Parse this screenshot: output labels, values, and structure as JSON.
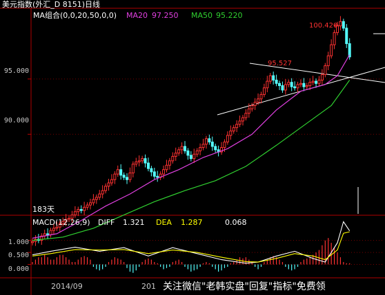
{
  "title": "美元指数(外汇_D 8151)日线",
  "legend": {
    "ma_params": "MA组合(0,0,20,50,0,0)",
    "ma20_label": "MA20",
    "ma20_value": "97.250",
    "ma50_label": "MA50",
    "ma50_value": "95.220"
  },
  "colors": {
    "up": "#ff3232",
    "down": "#54ffff",
    "ma20": "#e040e0",
    "ma50": "#30d030",
    "axis_text": "#c8c8c8",
    "grid": "#7a0000",
    "annotation": "#ff3232",
    "dif": "#ffffff",
    "dea": "#ffff00"
  },
  "annotations": {
    "high": "100.420",
    "high_arrow": "←",
    "mid_high": "95.527",
    "days": "183天"
  },
  "macd": {
    "title": "MACD(12,26,9)",
    "diff_label": "DIFF",
    "diff_value": "1.321",
    "dea_label": "DEA",
    "dea_value": "1.287",
    "macd_value": "0.068"
  },
  "watermark": "关注微信\"老韩实盘\"回复\"指标\"免费领",
  "chart_data": [
    {
      "type": "line",
      "title": "美元指数(外汇_D 8151)日线",
      "y_ticks": [
        "95.000",
        "90.000"
      ],
      "y_tick_values": [
        95.0,
        90.0
      ],
      "ylim": [
        82.8,
        101.4
      ],
      "x_tick_labels": [
        "2014/09",
        "201"
      ],
      "grid": true,
      "candles": {
        "start": 80.2,
        "closes": [
          80.3,
          80.5,
          80.4,
          80.8,
          81.0,
          80.9,
          81.3,
          81.5,
          81.6,
          81.9,
          82.1,
          82.3,
          82.4,
          82.7,
          83.0,
          83.2,
          83.1,
          83.4,
          83.6,
          83.8,
          84.1,
          84.3,
          84.6,
          84.9,
          85.3,
          85.6,
          85.9,
          86.4,
          86.8,
          86.3,
          86.1,
          85.9,
          86.5,
          87.3,
          87.5,
          87.6,
          87.8,
          87.4,
          86.9,
          86.6,
          86.2,
          86.1,
          86.4,
          86.8,
          87.2,
          87.6,
          88.0,
          88.3,
          88.6,
          88.9,
          88.5,
          88.1,
          87.8,
          88.2,
          88.5,
          88.8,
          89.1,
          89.6,
          89.3,
          88.9,
          88.6,
          88.4,
          88.8,
          89.3,
          89.9,
          90.3,
          90.6,
          90.9,
          91.2,
          91.5,
          91.9,
          92.3,
          92.6,
          92.9,
          93.2,
          93.6,
          94.2,
          94.8,
          95.3,
          94.9,
          94.6,
          94.4,
          94.0,
          94.5,
          94.7,
          94.3,
          94.2,
          94.5,
          94.6,
          94.3,
          94.4,
          94.7,
          94.8,
          94.6,
          94.9,
          95.4,
          96.2,
          97.1,
          98.1,
          99.2,
          99.8,
          100.2,
          99.6,
          98.2,
          97.0
        ]
      },
      "series": [
        {
          "name": "MA20",
          "color_key": "ma20",
          "points": [
            [
              0,
              80.6
            ],
            [
              8,
              81.0
            ],
            [
              16,
              82.2
            ],
            [
              24,
              83.5
            ],
            [
              32,
              84.6
            ],
            [
              40,
              85.9
            ],
            [
              48,
              86.8
            ],
            [
              56,
              87.9
            ],
            [
              64,
              88.7
            ],
            [
              72,
              90.0
            ],
            [
              80,
              92.2
            ],
            [
              88,
              93.9
            ],
            [
              96,
              94.5
            ],
            [
              100,
              95.3
            ],
            [
              104,
              97.2
            ]
          ]
        },
        {
          "name": "MA50",
          "color_key": "ma50",
          "points": [
            [
              0,
              80.4
            ],
            [
              10,
              80.7
            ],
            [
              20,
              81.5
            ],
            [
              30,
              82.7
            ],
            [
              40,
              83.9
            ],
            [
              50,
              84.9
            ],
            [
              60,
              85.8
            ],
            [
              70,
              87.1
            ],
            [
              80,
              89.0
            ],
            [
              90,
              91.0
            ],
            [
              98,
              92.6
            ],
            [
              104,
              94.9
            ]
          ]
        }
      ]
    },
    {
      "type": "line",
      "title": "MACD(12,26,9)",
      "y_ticks": [
        "1.000",
        "0.500",
        "0.000"
      ],
      "y_tick_values": [
        1.0,
        0.5,
        0.0
      ],
      "ylim": [
        -0.5,
        2.05
      ],
      "series": [
        {
          "name": "DIFF",
          "color_key": "dif",
          "points": [
            [
              0,
              0.4
            ],
            [
              6,
              0.55
            ],
            [
              14,
              0.72
            ],
            [
              22,
              0.55
            ],
            [
              30,
              0.7
            ],
            [
              38,
              0.35
            ],
            [
              46,
              0.7
            ],
            [
              54,
              0.45
            ],
            [
              62,
              0.2
            ],
            [
              70,
              0.05
            ],
            [
              74,
              0.1
            ],
            [
              80,
              0.35
            ],
            [
              86,
              0.55
            ],
            [
              92,
              0.25
            ],
            [
              96,
              0.1
            ],
            [
              100,
              0.9
            ],
            [
              102,
              1.78
            ],
            [
              104,
              1.4
            ]
          ]
        },
        {
          "name": "DEA",
          "color_key": "dea",
          "points": [
            [
              0,
              0.35
            ],
            [
              6,
              0.45
            ],
            [
              14,
              0.62
            ],
            [
              22,
              0.6
            ],
            [
              30,
              0.62
            ],
            [
              38,
              0.45
            ],
            [
              46,
              0.6
            ],
            [
              54,
              0.5
            ],
            [
              62,
              0.3
            ],
            [
              70,
              0.12
            ],
            [
              74,
              0.1
            ],
            [
              80,
              0.25
            ],
            [
              86,
              0.45
            ],
            [
              92,
              0.35
            ],
            [
              96,
              0.2
            ],
            [
              100,
              0.6
            ],
            [
              102,
              1.3
            ],
            [
              104,
              1.36
            ]
          ]
        }
      ],
      "histogram": [
        0.1,
        0.2,
        0.3,
        0.3,
        0.4,
        0.3,
        0.2,
        0.2,
        0.3,
        0.4,
        0.4,
        0.3,
        0.2,
        0.1,
        0.1,
        0.2,
        0.3,
        0.35,
        0.3,
        0.2,
        -0.1,
        -0.2,
        -0.25,
        -0.2,
        -0.1,
        0.1,
        0.2,
        0.3,
        0.25,
        0.2,
        0.1,
        -0.15,
        -0.3,
        -0.35,
        -0.25,
        -0.1,
        0.1,
        0.2,
        0.25,
        0.2,
        0.1,
        0.05,
        -0.1,
        -0.2,
        -0.15,
        -0.1,
        0.1,
        0.15,
        0.2,
        0.1,
        -0.1,
        -0.2,
        -0.3,
        -0.25,
        -0.2,
        -0.1,
        0.05,
        0.1,
        0.05,
        -0.1,
        -0.2,
        -0.3,
        -0.25,
        -0.15,
        -0.1,
        0.05,
        0.1,
        0.2,
        0.3,
        0.25,
        0.3,
        0.2,
        0.1,
        -0.1,
        -0.2,
        -0.1,
        0.1,
        0.2,
        0.3,
        0.35,
        0.3,
        0.2,
        0.1,
        -0.1,
        -0.2,
        -0.25,
        -0.2,
        -0.1,
        0.1,
        0.2,
        0.25,
        0.3,
        0.4,
        0.5,
        0.6,
        0.8,
        1.0,
        1.1,
        0.9,
        0.7,
        0.5,
        0.3,
        0.1,
        0.05,
        0.05
      ]
    }
  ]
}
